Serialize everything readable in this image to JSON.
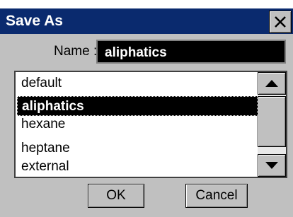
{
  "dialog": {
    "title": "Save As",
    "close_icon": "close-icon"
  },
  "name_field": {
    "label": "Name :",
    "value": "aliphatics"
  },
  "list": {
    "items": [
      "default",
      "aliphatics",
      "hexane",
      "heptane",
      "external"
    ],
    "selected": "aliphatics"
  },
  "scrollbar": {
    "up_icon": "arrow-up-icon",
    "down_icon": "arrow-down-icon"
  },
  "buttons": {
    "ok_label": "OK",
    "cancel_label": "Cancel"
  },
  "colors": {
    "titlebar": "#0a2a6e",
    "dialog_bg": "#c0c0c0",
    "selection_bg": "#000000",
    "selection_fg": "#ffffff"
  }
}
